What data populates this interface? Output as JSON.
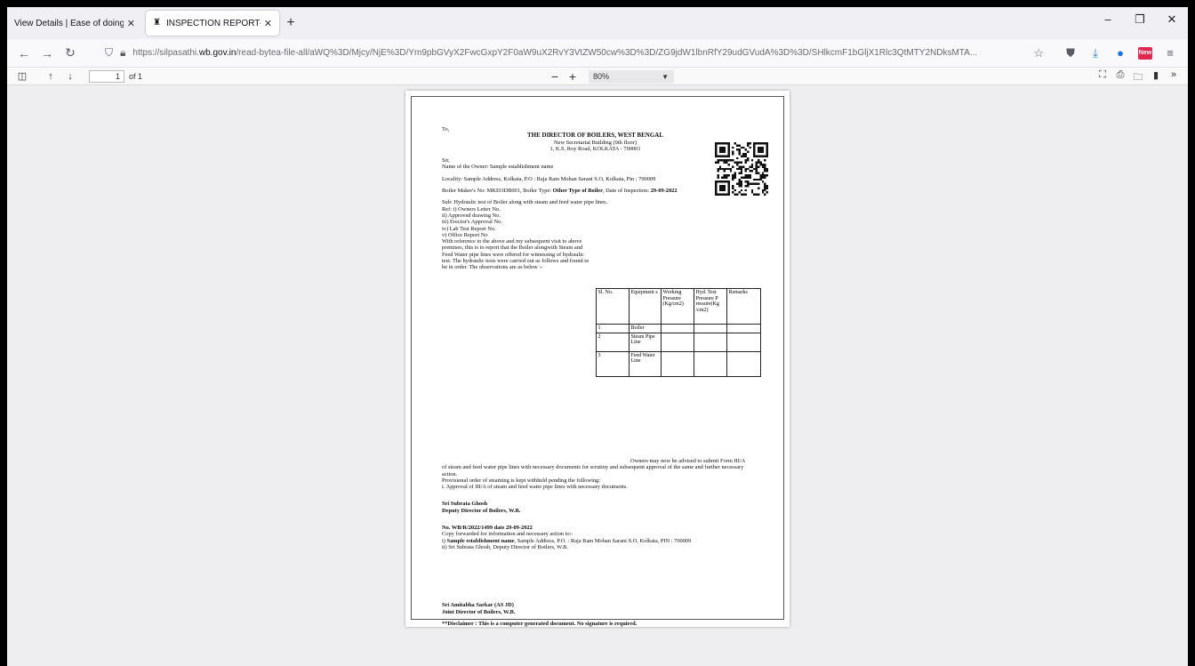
{
  "tabs": [
    {
      "title": "View Details | Ease of doing business",
      "active": false
    },
    {
      "title": "INSPECTION REPORT--Hydraulic",
      "active": true
    }
  ],
  "window_controls": {
    "minimize": "–",
    "restore": "❐",
    "close": "✕"
  },
  "nav": {
    "url_prefix": "https://silpasathi.",
    "url_host": "wb.gov.in",
    "url_rest": "/read-bytea-file-all/aWQ%3D/Mjcy/NjE%3D/Ym9pbGVyX2FwcGxpY2F0aW9uX2RvY3VtZW50cw%3D%3D/ZG9jdW1lbnRfY29udGVudA%3D%3D/SHlkcmF1bGljX1Rlc3QtMTY2NDksMTA..."
  },
  "pdf_toolbar": {
    "page_current": "1",
    "page_total": "of 1",
    "zoom": "80%"
  },
  "document": {
    "to": "To,",
    "director_title": "THE DIRECTOR OF BOILERS, WEST BENGAL",
    "address1": "New Secretariat Building (9th floor)",
    "address2": "1, K.S. Roy Road, KOLKATA - 700001",
    "sir": "Sir,",
    "owner_line": "Name of the Owner: Sample establishment name",
    "locality": "Locality: Sample Address, Kolkata, P.O : Raja Ram Mohan Sarani S.O, Kolkata, Pin : 700009",
    "maker_prefix": "Boiler Maker's No: MKEODB001,  Boiler Type: ",
    "boiler_type": "Other Type of Boiler",
    "inspection_prefix": ",  Date of Inspection: ",
    "inspection_date": "29-09-2022",
    "sub": "Sub: Hydraulic test of Boiler along with steam and feed water pipe lines.",
    "ref_lines": [
      "Ref: i) Owners Letter No.",
      "ii) Approved drawing No.",
      "iii) Erector's Approval No.",
      "iv) Lab Test Report No.",
      "v) Office Report No"
    ],
    "para1": "With reference to the above and my subsequent visit to above premises, this is to report that the Boiler alongwith Steam and Feed Water pipe lines were offered for witnessing of hydraulic test. The hydraulic tests were carried out as follows and found to be in order. The observations are as below :-",
    "table_headers": [
      "Sl. No.",
      "Equipment s",
      "Working Pressure (Kg/cm2)",
      "Hyd. Test Pressure P ressure(Kg /cm2)",
      "Remarks"
    ],
    "table_rows": [
      [
        "1",
        "Boiler",
        "",
        "",
        ""
      ],
      [
        "2",
        "Steam Pipe Line",
        "",
        "",
        ""
      ],
      [
        "3",
        "Feed Water Line",
        "",
        "",
        ""
      ]
    ],
    "para2": "Owners may now be advised to submit Form III/A of steam and feed water pipe lines with necessary documents for scrutiny and subsequent approval of the same and further necessary action.",
    "provisional": "Provisional order of steaming is kept withheld pending the following:",
    "approval": "i. Approval of III/A of steam and feed water pipe lines with necessary documents.",
    "sign1_name": "Sri Subrata Ghosh",
    "sign1_title": "Deputy Director of Boilers, W.B.",
    "ref_no": "No. WB/R/2022/1499 date 29-09-2022",
    "copy_fwd": "Copy forwarded for information and necessary action to:-",
    "copy1_bold": "Sample establishment name",
    "copy1_rest": ", Sample Address, P.O. : Raja Ram Mohan Sarani S.O, Kolkata, PIN : 700009",
    "copy1_prefix": "i) ",
    "copy2": "ii) Sri Subrata Ghosh, Deputy Director of Boilers, W.B.",
    "sign2_name": "Sri Amitabha Sarkar (AS JD)",
    "sign2_title": "Joint Director of Boilers, W.B.",
    "disclaimer": "**Disclaimer : This is a computer generated document. No signature is required."
  }
}
